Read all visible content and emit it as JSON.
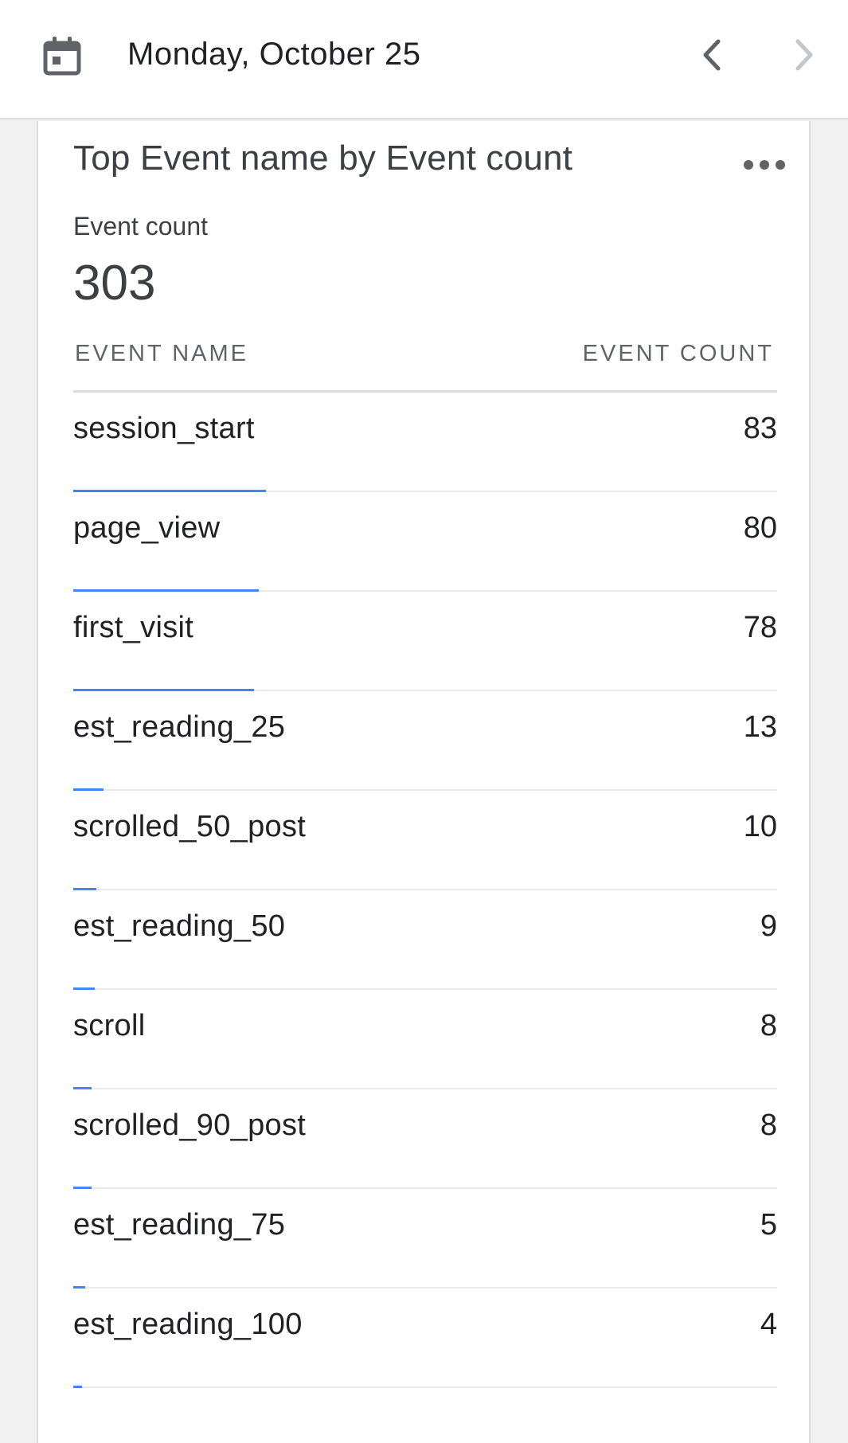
{
  "header": {
    "date": "Monday, October 25",
    "calendar_icon": "calendar-icon",
    "prev_icon": "chevron-left-icon",
    "next_icon": "chevron-right-icon"
  },
  "card": {
    "title": "Top Event name by Event count",
    "more_icon": "more-horizontal-icon",
    "metric_label": "Event count",
    "metric_value": "303",
    "col_event_name": "EVENT NAME",
    "col_event_count": "EVENT COUNT",
    "bar_color": "#4285f4",
    "rows": [
      {
        "name": "session_start",
        "count": "83",
        "share": 0.274
      },
      {
        "name": "page_view",
        "count": "80",
        "share": 0.264
      },
      {
        "name": "first_visit",
        "count": "78",
        "share": 0.257
      },
      {
        "name": "est_reading_25",
        "count": "13",
        "share": 0.043
      },
      {
        "name": "scrolled_50_post",
        "count": "10",
        "share": 0.033
      },
      {
        "name": "est_reading_50",
        "count": "9",
        "share": 0.03
      },
      {
        "name": "scroll",
        "count": "8",
        "share": 0.026
      },
      {
        "name": "scrolled_90_post",
        "count": "8",
        "share": 0.026
      },
      {
        "name": "est_reading_75",
        "count": "5",
        "share": 0.017
      },
      {
        "name": "est_reading_100",
        "count": "4",
        "share": 0.013
      }
    ]
  }
}
